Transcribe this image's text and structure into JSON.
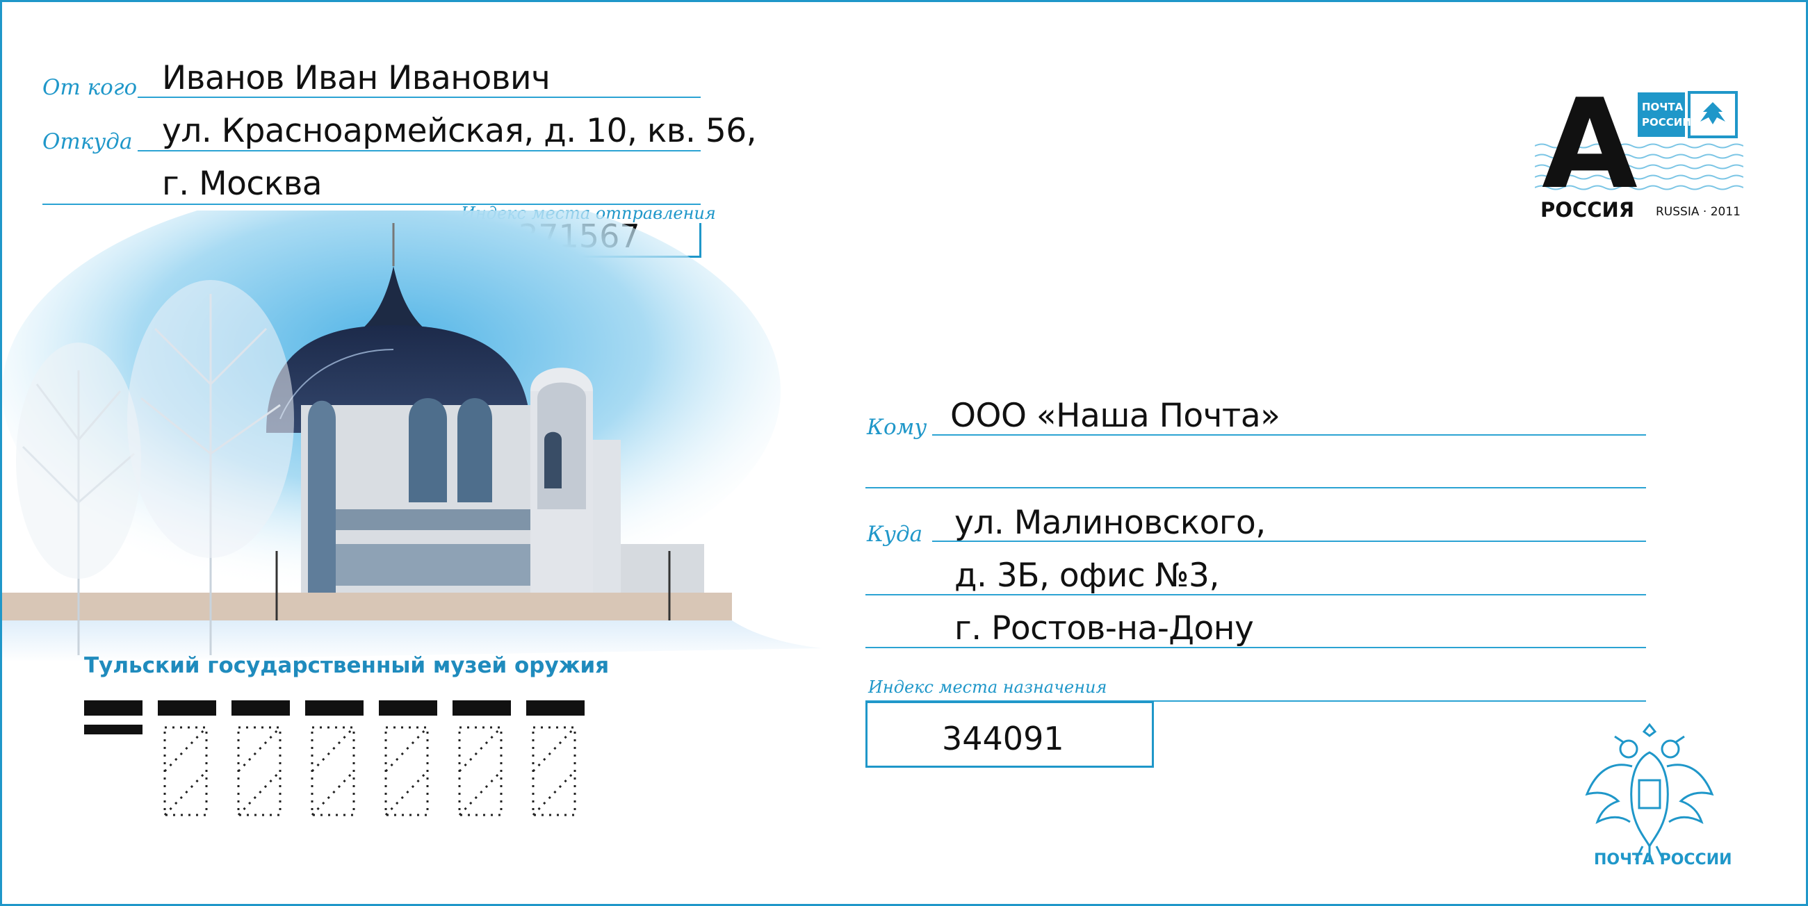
{
  "sender": {
    "from_label": "От кого",
    "from_value": "Иванов Иван Иванович",
    "where_label": "Откуда",
    "address_line1": "ул. Красноармейская, д. 10, кв. 56,",
    "address_line2": "г. Москва",
    "index_label": "Индекс места отправления",
    "index_value": "371567"
  },
  "recipient": {
    "to_label": "Кому",
    "to_value": "ООО «Наша Почта»",
    "where_label": "Куда",
    "address_line1": "ул. Малиновского,",
    "address_line2": "д. 3Б, офис №3,",
    "address_line3": "г. Ростов-на-Дону",
    "index_label": "Индекс места назначения",
    "index_value": "344091"
  },
  "picture": {
    "caption": "Тульский государственный музей оружия"
  },
  "stamp": {
    "letter": "А",
    "country": "РОССИЯ",
    "issue": "RUSSIA · 2011",
    "logo_text_line1": "ПОЧТА",
    "logo_text_line2": "РОССИИ"
  },
  "emblem": {
    "caption": "ПОЧТА РОССИИ",
    "icon": "double-headed-eagle-icon"
  },
  "colors": {
    "accent": "#1f97c9",
    "text": "#111111"
  }
}
